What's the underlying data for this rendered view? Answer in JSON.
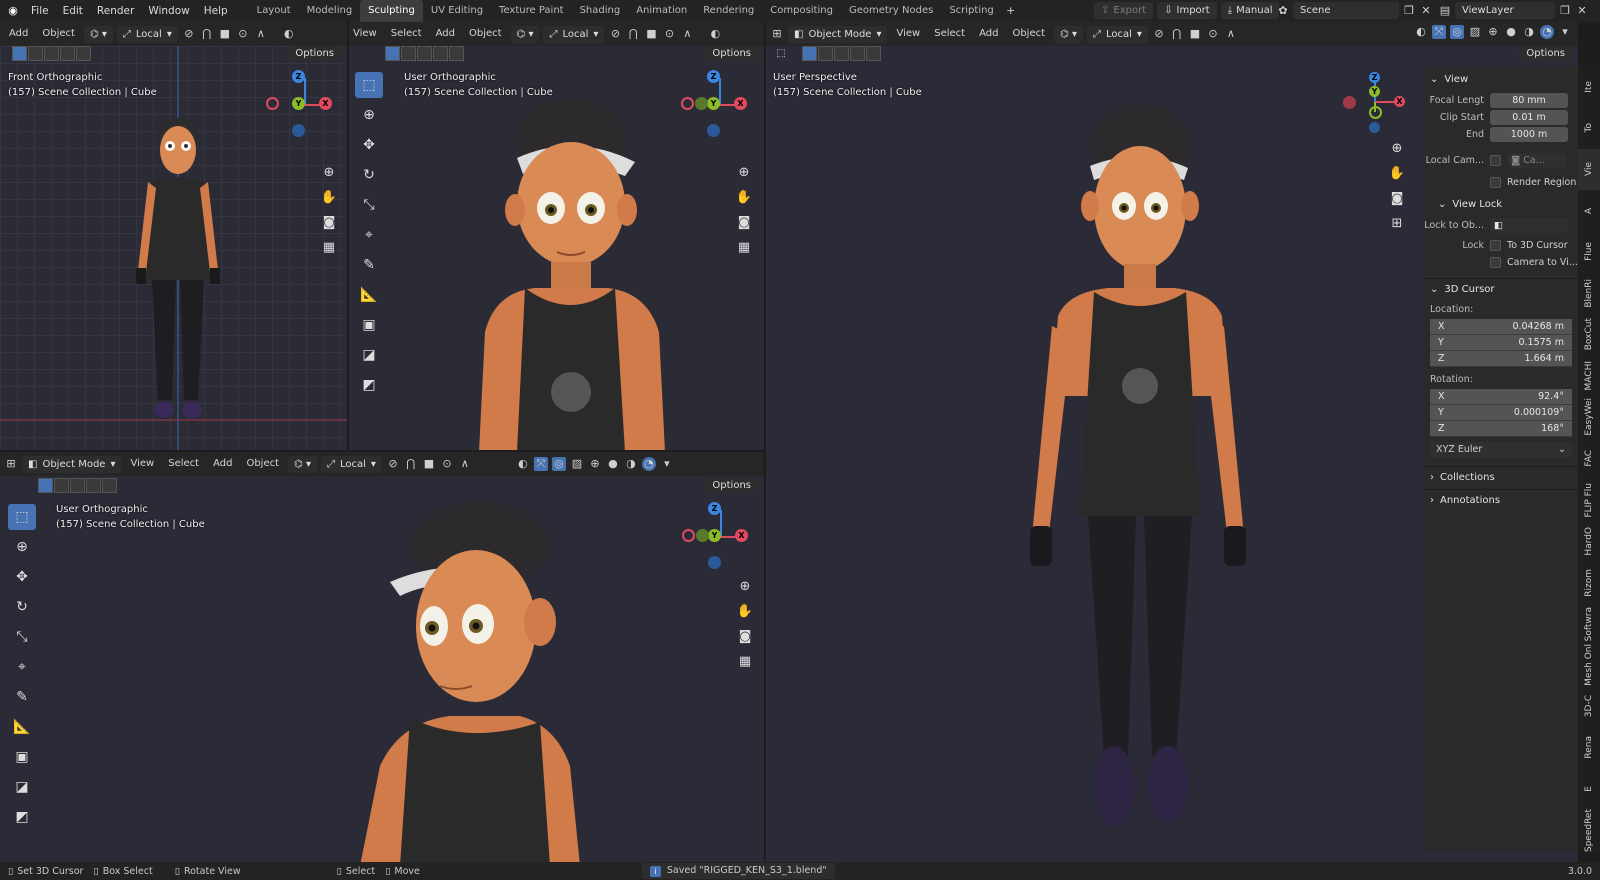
{
  "menu": [
    "File",
    "Edit",
    "Render",
    "Window",
    "Help"
  ],
  "workspaces": [
    "Layout",
    "Modeling",
    "Sculpting",
    "UV Editing",
    "Texture Paint",
    "Shading",
    "Animation",
    "Rendering",
    "Compositing",
    "Geometry Nodes",
    "Scripting"
  ],
  "active_workspace": "Sculpting",
  "topbar": {
    "export": "Export",
    "import": "Import",
    "manual": "Manual",
    "scene": "Scene",
    "view_layer": "ViewLayer"
  },
  "viewport_header": {
    "add": "Add",
    "object": "Object",
    "view": "View",
    "select": "Select",
    "local": "Local",
    "object_mode": "Object Mode",
    "options": "Options",
    "view_partial": "View"
  },
  "viewports": {
    "front": {
      "title": "Front Orthographic",
      "collection": "(157) Scene Collection | Cube"
    },
    "user1": {
      "title": "User Orthographic",
      "collection": "(157) Scene Collection | Cube"
    },
    "persp": {
      "title": "User Perspective",
      "collection": "(157) Scene Collection | Cube"
    },
    "user2": {
      "title": "User Orthographic",
      "collection": "(157) Scene Collection | Cube"
    }
  },
  "gizmo_labels": {
    "x": "X",
    "y": "Y",
    "z": "Z"
  },
  "npanel": {
    "view_header": "View",
    "focal_label": "Focal Lengt",
    "focal": "80 mm",
    "clip_start_label": "Clip Start",
    "clip_start": "0.01 m",
    "end_label": "End",
    "end": "1000 m",
    "local_cam_label": "Local Cam...",
    "local_cam_value": "Ca...",
    "render_region": "Render Region",
    "view_lock_header": "View Lock",
    "lock_to_obj_label": "Lock to Ob...",
    "lock_label": "Lock",
    "to_3d_cursor": "To 3D Cursor",
    "camera_to_view": "Camera to Vi...",
    "cursor_header": "3D Cursor",
    "location_label": "Location:",
    "loc": [
      {
        "axis": "X",
        "value": "0.04268 m"
      },
      {
        "axis": "Y",
        "value": "0.1575 m"
      },
      {
        "axis": "Z",
        "value": "1.664 m"
      }
    ],
    "rotation_label": "Rotation:",
    "rot": [
      {
        "axis": "X",
        "value": "92.4°"
      },
      {
        "axis": "Y",
        "value": "0.000109°"
      },
      {
        "axis": "Z",
        "value": "168°"
      }
    ],
    "rotation_mode": "XYZ Euler",
    "collections": "Collections",
    "annotations": "Annotations"
  },
  "side_tabs": [
    "Ite",
    "To",
    "Vie",
    "A",
    "Flue",
    "BlenRi",
    "BoxCut",
    "MACHI",
    "EasyWei",
    "FAC",
    "FLIP Flu",
    "HardO",
    "Rizom",
    "Softwra",
    "Mesh Onl",
    "3D-C",
    "Rena",
    "E",
    "SpeedRet"
  ],
  "status": {
    "set_cursor": "Set 3D Cursor",
    "box_select": "Box Select",
    "rotate_view": "Rotate View",
    "select": "Select",
    "move": "Move",
    "saved": "Saved \"RIGGED_KEN_S3_1.blend\"",
    "version": "3.0.0"
  },
  "colors": {
    "accent": "#4772b3",
    "x_axis": "#e04a5f",
    "y_axis": "#8bbd28",
    "z_axis": "#3b86e0",
    "viewport_bg": "#2b2b37"
  }
}
